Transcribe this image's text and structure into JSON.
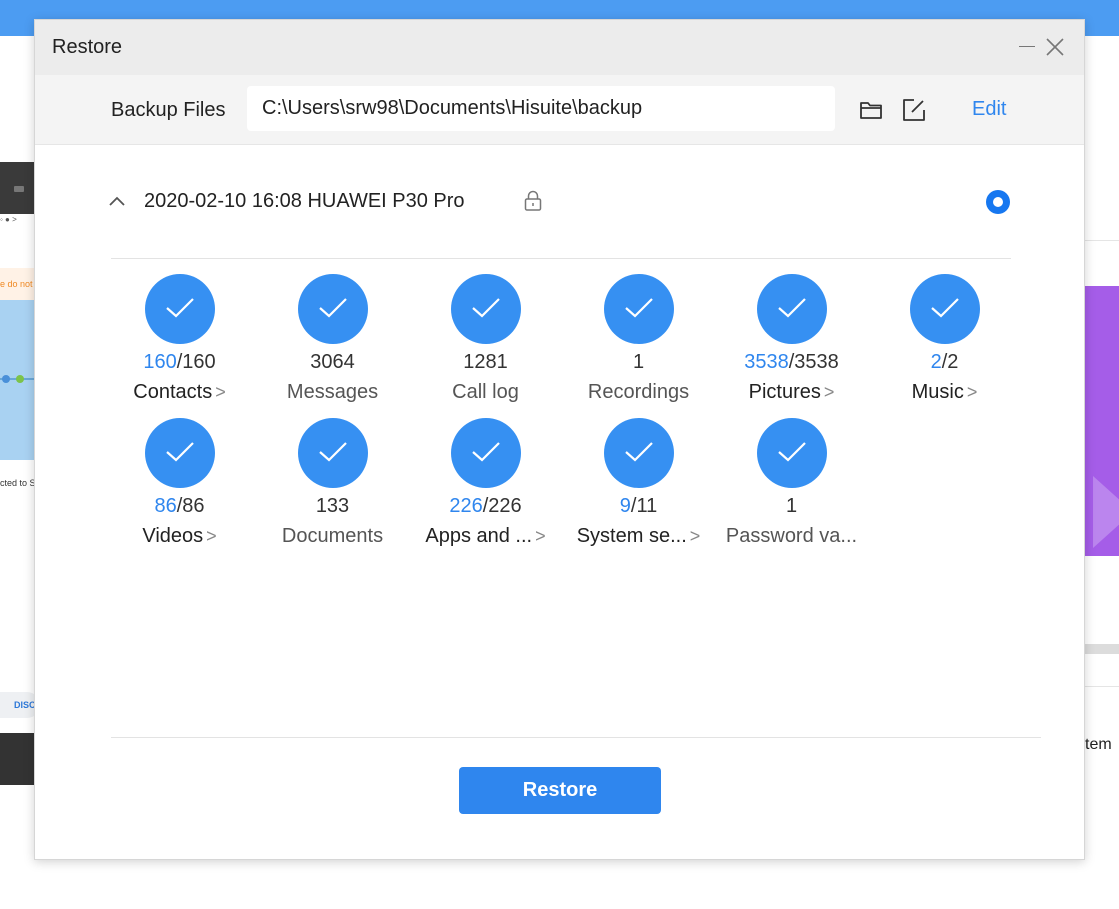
{
  "background": {
    "left_dots": "◦ ● >",
    "left_warning": "e do not",
    "left_caption": "cted to S",
    "left_pill": "DISC",
    "right_text": "tem"
  },
  "dialog": {
    "title": "Restore",
    "backup_files_label": "Backup Files",
    "backup_path": "C:\\Users\\srw98\\Documents\\Hisuite\\backup",
    "edit_label": "Edit",
    "backup": {
      "name": "2020-02-10 16:08 HUAWEI P30 Pro",
      "locked": true,
      "selected": true
    },
    "items": [
      {
        "selected": "160",
        "total": "/160",
        "label": "Contacts",
        "arrow": ">"
      },
      {
        "selected": "",
        "total": "3064",
        "label": "Messages",
        "arrow": ""
      },
      {
        "selected": "",
        "total": "1281",
        "label": "Call log",
        "arrow": ""
      },
      {
        "selected": "",
        "total": "1",
        "label": "Recordings",
        "arrow": ""
      },
      {
        "selected": "3538",
        "total": "/3538",
        "label": "Pictures",
        "arrow": ">"
      },
      {
        "selected": "2",
        "total": "/2",
        "label": "Music",
        "arrow": ">"
      },
      {
        "selected": "86",
        "total": "/86",
        "label": "Videos",
        "arrow": ">"
      },
      {
        "selected": "",
        "total": "133",
        "label": "Documents",
        "arrow": ""
      },
      {
        "selected": "226",
        "total": "/226",
        "label": "Apps and ...",
        "arrow": ">"
      },
      {
        "selected": "9",
        "total": "/11",
        "label": "System se...",
        "arrow": ">"
      },
      {
        "selected": "",
        "total": "1",
        "label": "Password va...",
        "arrow": ""
      }
    ],
    "restore_button": "Restore"
  },
  "colors": {
    "accent": "#2f86ee",
    "check": "#3690f2",
    "topbar": "#4c9cf2"
  }
}
